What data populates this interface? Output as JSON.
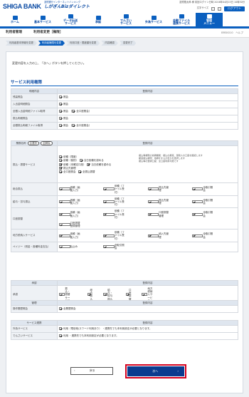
{
  "header": {
    "logo": "SHIGA BANK",
    "svc_l1": "滋賀銀行インターネットバンキング",
    "svc_l2": "しがぎんBizダイレクト",
    "user": "滋賀銀太郎 様",
    "last_login": "前回ログイン日時 2016年04月15日 10時30分",
    "fontsize_label": "文字サイズ",
    "logout": "ログアウト"
  },
  "nav": [
    {
      "label": "ホーム"
    },
    {
      "label": "基本サービス"
    },
    {
      "label": "データ伝送\nサービス"
    },
    {
      "label": "承認"
    },
    {
      "label": "でんさい\nサービス"
    },
    {
      "label": "外為サービス"
    },
    {
      "label": "金融ファイル\n連携サービス"
    },
    {
      "label": "管理\nメニュー"
    }
  ],
  "page": {
    "title": "利用者管理",
    "subtitle": "利用者変更［権限］",
    "screen_id": "BRSK010",
    "help": "ヘルプ"
  },
  "steps": [
    "利用者基本情報を変更",
    "利用者権限を変更",
    "利用口座・限度額を変更",
    "内容確認",
    "変更完了"
  ],
  "message": "変更内容を入力の上、「次へ」ボタンを押してください。",
  "section_title": "サービス利用権限",
  "col_item": "明細内容",
  "col_content": "登録内容",
  "basic_rows": [
    {
      "label": "残高照会",
      "v": "照会"
    },
    {
      "label": "入出金明細照会",
      "v": "照会"
    },
    {
      "label": "全銀入出金明細ファイル取得",
      "v": "照会",
      "v2": "全口座照会"
    },
    {
      "label": "振込明細照会",
      "v": "照会"
    },
    {
      "label": "全銀振込明細ファイル取得",
      "v": "照会",
      "v2": "全口座照会"
    }
  ],
  "furikomi": {
    "label": "振込・振替サービス",
    "head": "業務名称",
    "chip1": "全選択",
    "chip2": "全解除",
    "lines": [
      "依頼（限度）",
      "依頼（個別）",
      "依頼（未確定口座）"
    ],
    "sublines": [
      "当日依頼を認める",
      "当日依頼を認める"
    ],
    "notes": [
      "振込等権限の依頼機能：振込の都度、受取人の口座を確認します",
      "都度振込権限：依頼をするか否かを選択します",
      "振込等の登録口座：全口座利用可能です"
    ],
    "extra": [
      "振込先管理",
      "全口座照会",
      "全振込振替"
    ]
  },
  "sogo": {
    "label": "総合振込",
    "items": [
      "依頼（画面入力）",
      "依頼（ファイル受付）",
      "振込先管理",
      "全取引照会"
    ]
  },
  "kyuyo": {
    "label": "給与・賞与振込",
    "items": [
      "依頼（画面入力）",
      "依頼（ファイル受付）",
      "振込先管理",
      "全取引照会"
    ]
  },
  "koza": {
    "label": "口座振替",
    "items": [
      "依頼（画面入力）",
      "依頼（ファイル受付）",
      "口座振替管理",
      "全取引照会"
    ],
    "extra": "口座振替登録管理"
  },
  "chiho": {
    "label": "地方税納入サービス",
    "items": [
      "依頼（画面入力）",
      "依頼（ファイル受付）",
      "納入先管理",
      "全取引照会"
    ]
  },
  "payeasy": {
    "label": "ペイジー（税金・各種料金支払）",
    "items": [
      "払込み",
      "全取引照会"
    ]
  },
  "approve_title": "承認",
  "approve_col": "登録内容",
  "approve_label": "承認",
  "approve_items": [
    "振込・振替サービス",
    "総合振込",
    "給与・賞与振込",
    "口座振替",
    "地方税納入サービス"
  ],
  "kanri_title": "管理",
  "kanri_col": "登録内容",
  "kanri_label": "操作履歴照会",
  "kanri_v": "全履歴照会",
  "renkei_title": "サービス連携",
  "renkei_col": "登録内容",
  "gaitame": {
    "label": "外為サービス",
    "v": "利用（電信他/スワード利用あり）",
    "note": "・連携先でも本利用設定が必要となります。"
  },
  "densai": {
    "label": "でんさいサービス",
    "v": "利用 ・連携先でも本利用設定が必要となります。"
  },
  "buttons": {
    "back": "戻る",
    "next": "次へ"
  }
}
